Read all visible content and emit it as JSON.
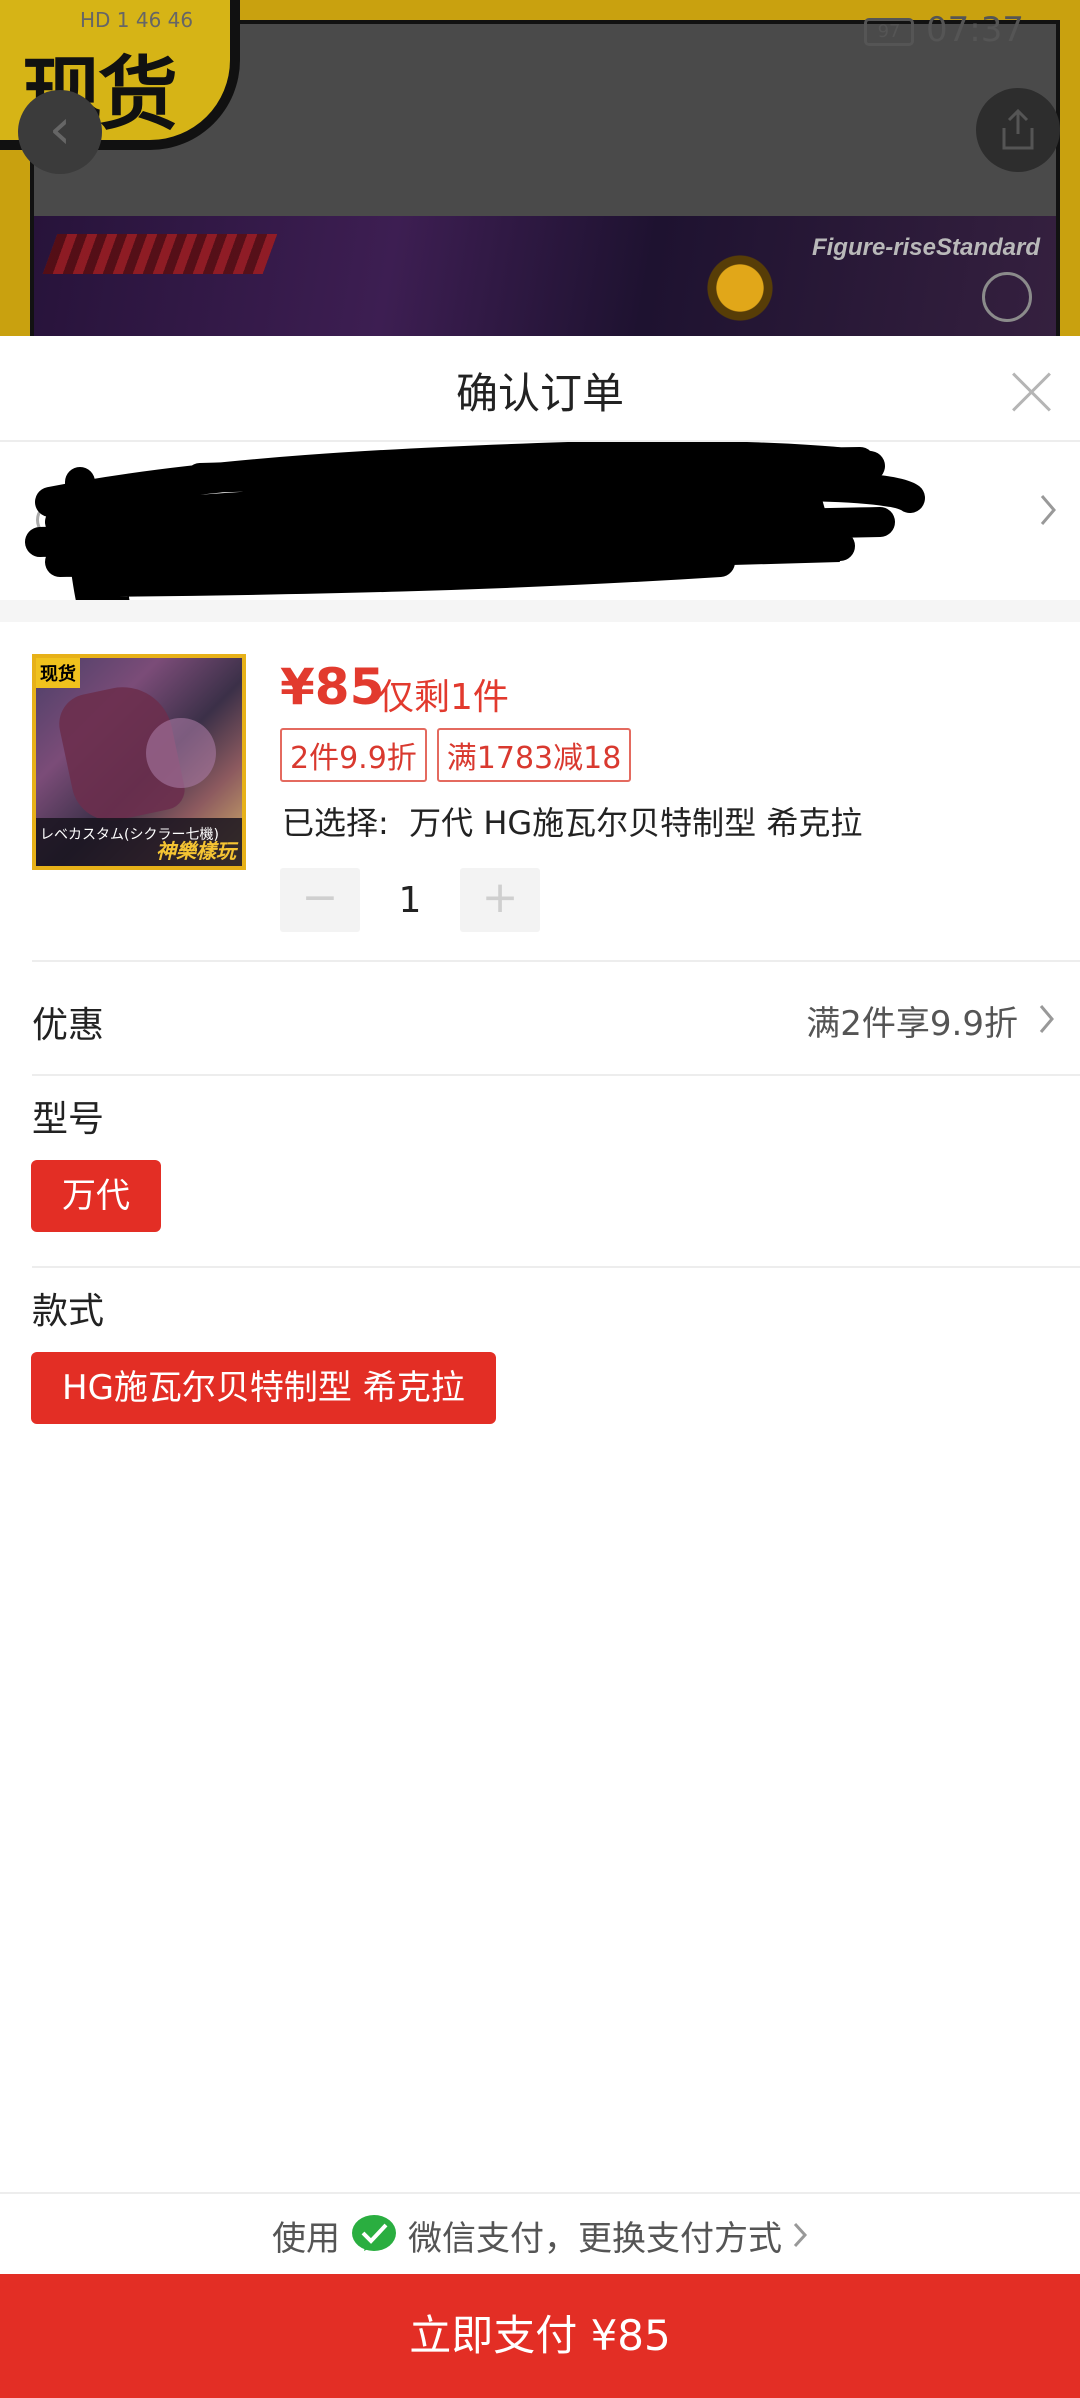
{
  "background": {
    "badge_text": "现货",
    "status_left": "HD 1 46 46",
    "battery": "97",
    "time": "07:37",
    "banner_logo": "Figure-riseStandard"
  },
  "sheet": {
    "title": "确认订单"
  },
  "product": {
    "image_tag": "现货",
    "image_caption_jp": "レベカスタム(シクラー七機)",
    "image_caption_gold": "神樂樣玩",
    "price": "¥85",
    "stock": "仅剩1件",
    "promo_tags": [
      "2件9.9折",
      "满1783减18"
    ],
    "selected_label": "已选择:",
    "selected_value": "万代 HG施瓦尔贝特制型 希克拉",
    "quantity": "1",
    "minus": "−",
    "plus": "+"
  },
  "discount": {
    "label": "优惠",
    "value": "满2件享9.9折"
  },
  "model": {
    "label": "型号",
    "option": "万代"
  },
  "style": {
    "label": "款式",
    "option": "HG施瓦尔贝特制型 希克拉"
  },
  "footer": {
    "use": "使用",
    "method": "微信支付，更换支付方式",
    "pay_button": "立即支付 ¥85"
  },
  "colors": {
    "accent_red": "#e32e25",
    "price_red": "#e23a2e",
    "wechat_green": "#2aae40"
  }
}
